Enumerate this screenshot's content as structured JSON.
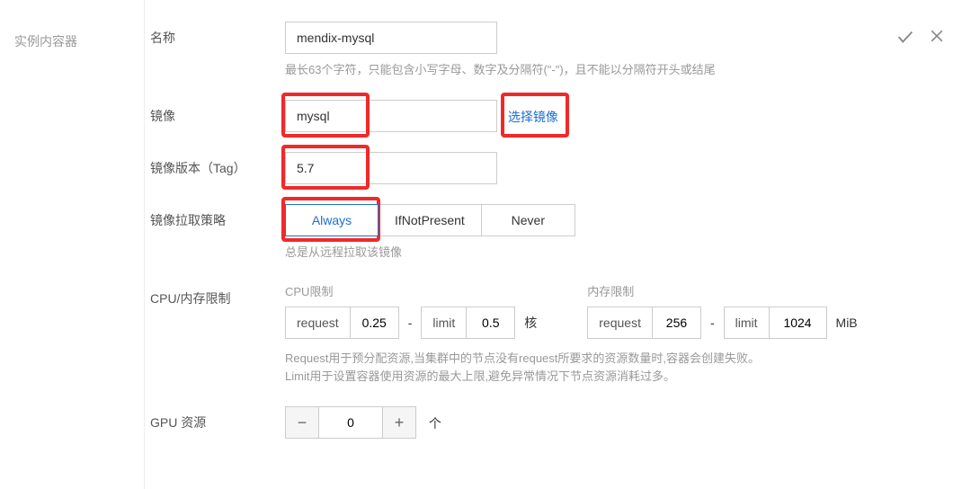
{
  "section_title": "实例内容器",
  "name": {
    "label": "名称",
    "value": "mendix-mysql",
    "help": "最长63个字符，只能包含小写字母、数字及分隔符(\"-\")，且不能以分隔符开头或结尾"
  },
  "image": {
    "label": "镜像",
    "value": "mysql",
    "select_link": "选择镜像"
  },
  "image_tag": {
    "label": "镜像版本（Tag）",
    "value": "5.7"
  },
  "pull_policy": {
    "label": "镜像拉取策略",
    "options": [
      "Always",
      "IfNotPresent",
      "Never"
    ],
    "help": "总是从远程拉取该镜像"
  },
  "cpu_mem": {
    "label": "CPU/内存限制",
    "cpu": {
      "title": "CPU限制",
      "request_label": "request",
      "request": "0.25",
      "limit_label": "limit",
      "limit": "0.5",
      "unit": "核"
    },
    "mem": {
      "title": "内存限制",
      "request_label": "request",
      "request": "256",
      "limit_label": "limit",
      "limit": "1024",
      "unit": "MiB"
    },
    "help1": "Request用于预分配资源,当集群中的节点没有request所要求的资源数量时,容器会创建失败。",
    "help2": "Limit用于设置容器使用资源的最大上限,避免异常情况下节点资源消耗过多。"
  },
  "gpu": {
    "label": "GPU 资源",
    "value": "0",
    "unit": "个"
  }
}
